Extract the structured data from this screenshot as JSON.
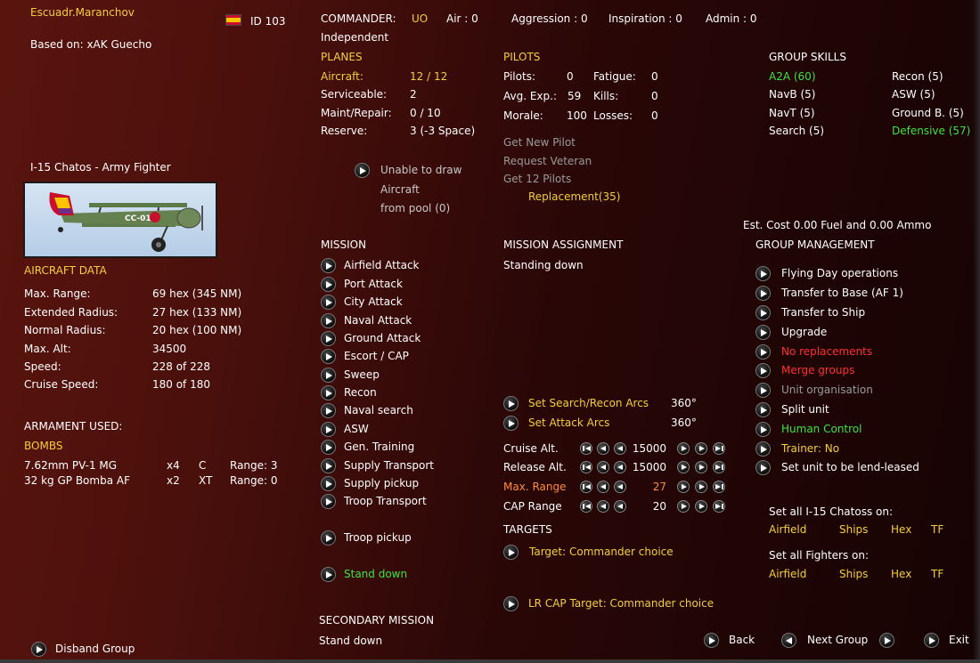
{
  "unit": {
    "name": "Escuadr.Maranchov",
    "id": "ID 103",
    "based_on": "Based on: xAK Guecho",
    "aircraft_type": "I-15 Chatos - Army Fighter",
    "aircraft_marking": "CC-010"
  },
  "aircraft_data": {
    "title": "AIRCRAFT DATA",
    "rows": [
      {
        "label": "Max. Range:",
        "value": "69 hex (345 NM)"
      },
      {
        "label": "Extended Radius:",
        "value": "27 hex (133 NM)"
      },
      {
        "label": "Normal Radius:",
        "value": "20 hex (100 NM)"
      },
      {
        "label": "Max. Alt:",
        "value": "34500"
      },
      {
        "label": "Speed:",
        "value": "228 of 228"
      },
      {
        "label": "Cruise Speed:",
        "value": "180 of 180"
      }
    ]
  },
  "armament": {
    "title": "ARMAMENT USED:",
    "section": "BOMBS",
    "rows": [
      {
        "name": "7.62mm PV-1 MG",
        "qty": "x4",
        "type": "C",
        "range": "Range: 3"
      },
      {
        "name": "32 kg GP Bomba AF",
        "qty": "x2",
        "type": "XT",
        "range": "Range: 0"
      }
    ]
  },
  "disband_label": "Disband Group",
  "commander": {
    "label": "COMMANDER:",
    "name": "UO",
    "air": "Air : 0",
    "aggression": "Aggression : 0",
    "inspiration": "Inspiration : 0",
    "admin": "Admin : 0",
    "affiliation": "Independent"
  },
  "planes": {
    "title": "PLANES",
    "aircraft_label": "Aircraft:",
    "aircraft_value": "12 / 12",
    "serviceable_label": "Serviceable:",
    "serviceable_value": "2",
    "maint_label": "Maint/Repair:",
    "maint_value": "0 / 10",
    "reserve_label": "Reserve:",
    "reserve_value": "3 (-3 Space)",
    "pool_lines": [
      "Unable to draw",
      "Aircraft",
      "from pool (0)"
    ]
  },
  "pilots": {
    "title": "PILOTS",
    "pilots_label": "Pilots:",
    "pilots_value": "0",
    "fatigue_label": "Fatigue:",
    "fatigue_value": "0",
    "avgexp_label": "Avg. Exp.:",
    "avgexp_value": "59",
    "kills_label": "Kills:",
    "kills_value": "0",
    "morale_label": "Morale:",
    "morale_value": "100",
    "losses_label": "Losses:",
    "losses_value": "0",
    "actions": [
      "Get New Pilot",
      "Request Veteran",
      "Get 12 Pilots"
    ],
    "replacement": "Replacement(35)"
  },
  "group_skills": {
    "title": "GROUP SKILLS",
    "left": [
      "A2A (60)",
      "NavB (5)",
      "NavT (5)",
      "Search (5)"
    ],
    "right": [
      "Recon (5)",
      "ASW (5)",
      "Ground B. (5)",
      "Defensive (57)"
    ]
  },
  "est_cost": "Est. Cost 0.00 Fuel and 0.00 Ammo",
  "mission": {
    "title": "MISSION",
    "items": [
      "Airfield Attack",
      "Port Attack",
      "City Attack",
      "Naval Attack",
      "Ground Attack",
      "Escort / CAP",
      "Sweep",
      "Recon",
      "Naval search",
      "ASW",
      "Gen. Training",
      "Supply Transport",
      "Supply pickup",
      "Troop Transport",
      "Troop pickup",
      "Stand down"
    ]
  },
  "mission_assignment": {
    "title": "MISSION ASSIGNMENT",
    "value": "Standing down",
    "search_arcs": "Set Search/Recon Arcs",
    "search_arcs_value": "360°",
    "attack_arcs": "Set Attack Arcs",
    "attack_arcs_value": "360°",
    "cruise_label": "Cruise Alt.",
    "cruise_value": "15000",
    "release_label": "Release Alt.",
    "release_value": "15000",
    "maxrange_label": "Max. Range",
    "maxrange_value": "27",
    "cap_label": "CAP Range",
    "cap_value": "20"
  },
  "targets": {
    "title": "TARGETS",
    "target": "Target: Commander choice",
    "lrcap": "LR CAP Target: Commander choice"
  },
  "secondary": {
    "title": "SECONDARY MISSION",
    "value": "Stand down"
  },
  "group_management": {
    "title": "GROUP MANAGEMENT",
    "items": [
      "Flying Day operations",
      "Transfer to Base (AF 1)",
      "Transfer to Ship",
      "Upgrade",
      "No replacements",
      "Merge groups",
      "Unit organisation",
      "Split unit",
      "Human Control",
      "Trainer: No",
      "Set unit to be lend-leased"
    ]
  },
  "set_all_type": {
    "title": "Set all I-15 Chatoss on:",
    "options": [
      "Airfield",
      "Ships",
      "Hex",
      "TF"
    ]
  },
  "set_all_fighters": {
    "title": "Set all Fighters on:",
    "options": [
      "Airfield",
      "Ships",
      "Hex",
      "TF"
    ]
  },
  "nav": {
    "back": "Back",
    "next": "Next Group",
    "exit": "Exit"
  },
  "colors": {
    "yellow": "#f2cf3c",
    "green": "#3fe33f",
    "red": "#ff3030",
    "orange": "#ff8a3a",
    "grey": "#9a9a9a"
  }
}
